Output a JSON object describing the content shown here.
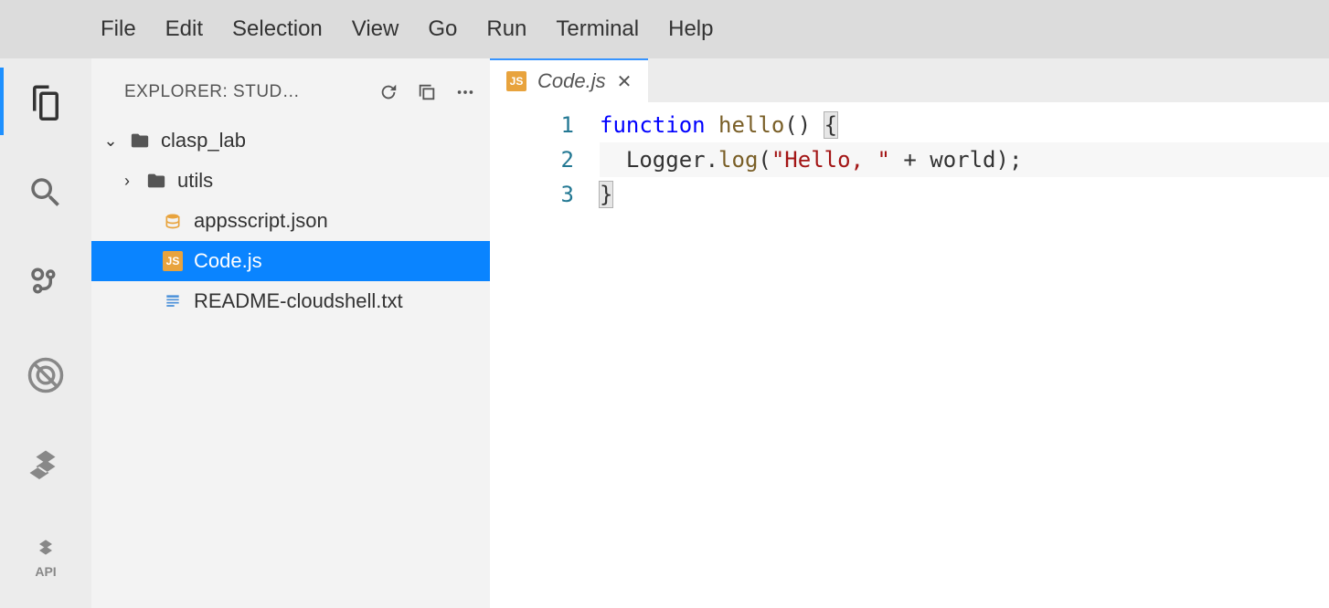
{
  "menubar": [
    "File",
    "Edit",
    "Selection",
    "View",
    "Go",
    "Run",
    "Terminal",
    "Help"
  ],
  "sidebar": {
    "header": "EXPLORER: STUD…",
    "tree": {
      "root": "clasp_lab",
      "folder": "utils",
      "file1": "appsscript.json",
      "file2": "Code.js",
      "file3": "README-cloudshell.txt"
    }
  },
  "tab": {
    "label": "Code.js",
    "badge": "JS"
  },
  "code": {
    "ln1": "1",
    "ln2": "2",
    "ln3": "3",
    "l1_kw": "function",
    "l1_fn": "hello",
    "l1_tail": "() ",
    "l2_pre": "  Logger.",
    "l2_log": "log",
    "l2_open": "(",
    "l2_str": "\"Hello, \"",
    "l2_rest": " + world);",
    "l3": "}"
  }
}
